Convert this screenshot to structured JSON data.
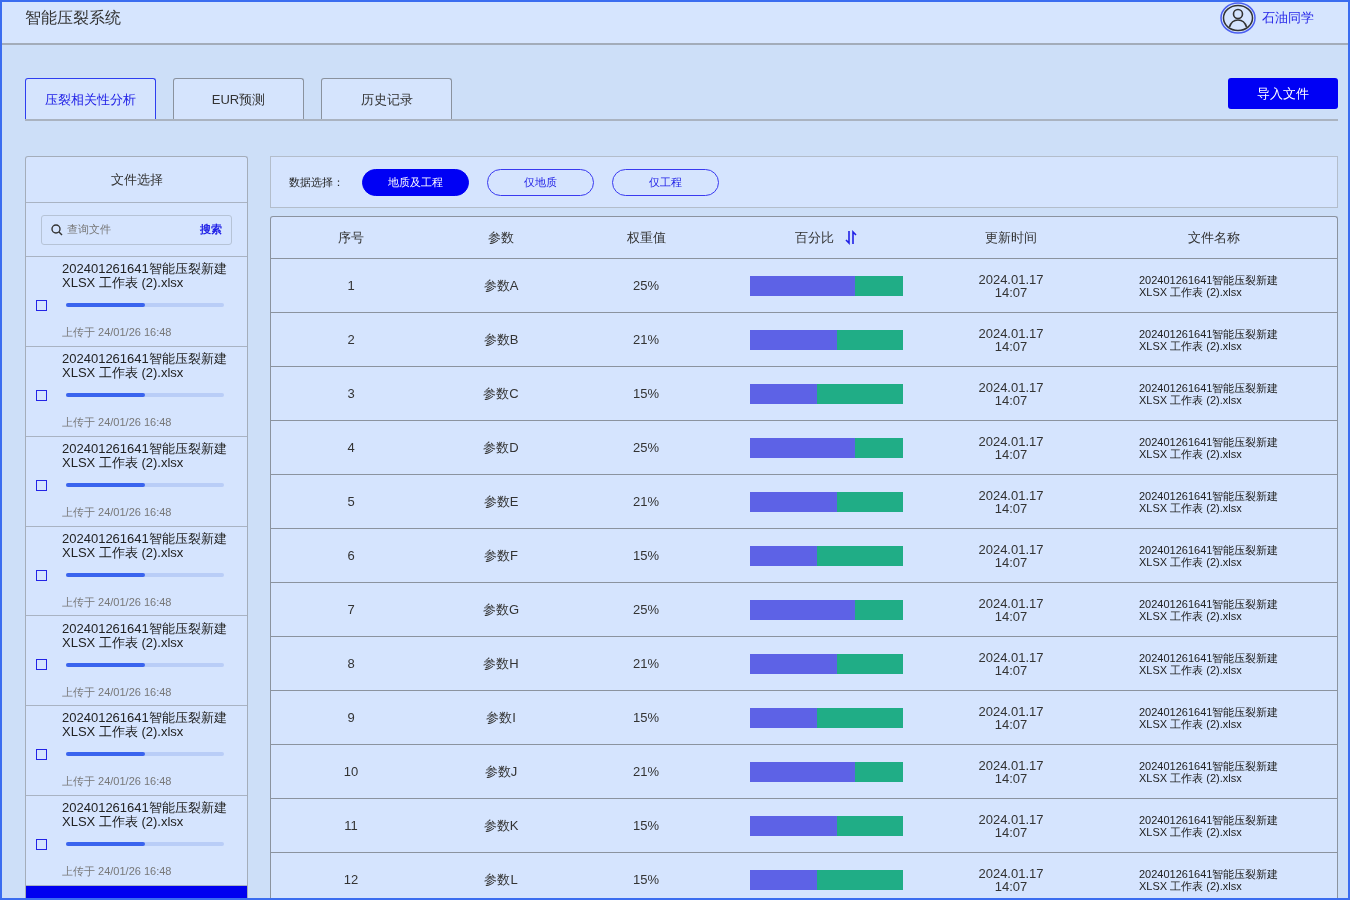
{
  "app_title": "智能压裂系统",
  "user": {
    "name": "石油同学"
  },
  "tabs": [
    {
      "label": "压裂相关性分析",
      "selected": true
    },
    {
      "label": "EUR预测",
      "selected": false
    },
    {
      "label": "历史记录",
      "selected": false
    }
  ],
  "import_button": "导入文件",
  "sidebar": {
    "title": "文件选择",
    "search": {
      "placeholder": "查询文件",
      "button": "搜索"
    },
    "files": [
      {
        "name": "202401261641智能压裂新建 XLSX 工作表 (2).xlsx",
        "checked": false,
        "level": 0.5,
        "uploaded": "上传于 24/01/26 16:48"
      },
      {
        "name": "202401261641智能压裂新建 XLSX 工作表 (2).xlsx",
        "checked": false,
        "level": 0.5,
        "uploaded": "上传于 24/01/26 16:48"
      },
      {
        "name": "202401261641智能压裂新建 XLSX 工作表 (2).xlsx",
        "checked": false,
        "level": 0.5,
        "uploaded": "上传于 24/01/26 16:48"
      },
      {
        "name": "202401261641智能压裂新建 XLSX 工作表 (2).xlsx",
        "checked": false,
        "level": 0.5,
        "uploaded": "上传于 24/01/26 16:48"
      },
      {
        "name": "202401261641智能压裂新建 XLSX 工作表 (2).xlsx",
        "checked": false,
        "level": 0.5,
        "uploaded": "上传于 24/01/26 16:48"
      },
      {
        "name": "202401261641智能压裂新建 XLSX 工作表 (2).xlsx",
        "checked": false,
        "level": 0.5,
        "uploaded": "上传于 24/01/26 16:48"
      },
      {
        "name": "202401261641智能压裂新建 XLSX 工作表 (2).xlsx",
        "checked": false,
        "level": 0.5,
        "uploaded": "上传于 24/01/26 16:48"
      }
    ]
  },
  "filter": {
    "label": "数据选择：",
    "options": [
      {
        "label": "地质及工程",
        "selected": true
      },
      {
        "label": "仅地质",
        "selected": false
      },
      {
        "label": "仅工程",
        "selected": false
      }
    ]
  },
  "table": {
    "columns": [
      "序号",
      "参数",
      "权重值",
      "百分比",
      "更新时间",
      "文件名称"
    ],
    "rows": [
      {
        "index": "1",
        "param": "参数A",
        "weight": "25%",
        "level": 0.69,
        "date": "2024.01.17",
        "time": "14:07",
        "file": "202401261641智能压裂新建 XLSX 工作表 (2).xlsx"
      },
      {
        "index": "2",
        "param": "参数B",
        "weight": "21%",
        "level": 0.57,
        "date": "2024.01.17",
        "time": "14:07",
        "file": "202401261641智能压裂新建 XLSX 工作表 (2).xlsx"
      },
      {
        "index": "3",
        "param": "参数C",
        "weight": "15%",
        "level": 0.44,
        "date": "2024.01.17",
        "time": "14:07",
        "file": "202401261641智能压裂新建 XLSX 工作表 (2).xlsx"
      },
      {
        "index": "4",
        "param": "参数D",
        "weight": "25%",
        "level": 0.69,
        "date": "2024.01.17",
        "time": "14:07",
        "file": "202401261641智能压裂新建 XLSX 工作表 (2).xlsx"
      },
      {
        "index": "5",
        "param": "参数E",
        "weight": "21%",
        "level": 0.57,
        "date": "2024.01.17",
        "time": "14:07",
        "file": "202401261641智能压裂新建 XLSX 工作表 (2).xlsx"
      },
      {
        "index": "6",
        "param": "参数F",
        "weight": "15%",
        "level": 0.44,
        "date": "2024.01.17",
        "time": "14:07",
        "file": "202401261641智能压裂新建 XLSX 工作表 (2).xlsx"
      },
      {
        "index": "7",
        "param": "参数G",
        "weight": "25%",
        "level": 0.69,
        "date": "2024.01.17",
        "time": "14:07",
        "file": "202401261641智能压裂新建 XLSX 工作表 (2).xlsx"
      },
      {
        "index": "8",
        "param": "参数H",
        "weight": "21%",
        "level": 0.57,
        "date": "2024.01.17",
        "time": "14:07",
        "file": "202401261641智能压裂新建 XLSX 工作表 (2).xlsx"
      },
      {
        "index": "9",
        "param": "参数I",
        "weight": "15%",
        "level": 0.44,
        "date": "2024.01.17",
        "time": "14:07",
        "file": "202401261641智能压裂新建 XLSX 工作表 (2).xlsx"
      },
      {
        "index": "10",
        "param": "参数J",
        "weight": "21%",
        "level": 0.69,
        "date": "2024.01.17",
        "time": "14:07",
        "file": "202401261641智能压裂新建 XLSX 工作表 (2).xlsx"
      },
      {
        "index": "11",
        "param": "参数K",
        "weight": "15%",
        "level": 0.57,
        "date": "2024.01.17",
        "time": "14:07",
        "file": "202401261641智能压裂新建 XLSX 工作表 (2).xlsx"
      },
      {
        "index": "12",
        "param": "参数L",
        "weight": "15%",
        "level": 0.44,
        "date": "2024.01.17",
        "time": "14:07",
        "file": "202401261641智能压裂新建 XLSX 工作表 (2).xlsx"
      }
    ]
  }
}
